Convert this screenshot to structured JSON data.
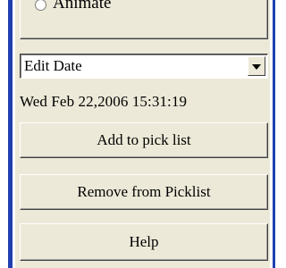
{
  "animate": {
    "label": "Animate"
  },
  "field_select": {
    "value": "Edit Date"
  },
  "date_display": "Wed Feb 22,2006  15:31:19",
  "buttons": {
    "add_label": "Add to pick list",
    "remove_label": "Remove from Picklist",
    "help_label": "Help"
  },
  "colors": {
    "panel": "#ece9d8",
    "frame": "#1f3fb0"
  }
}
